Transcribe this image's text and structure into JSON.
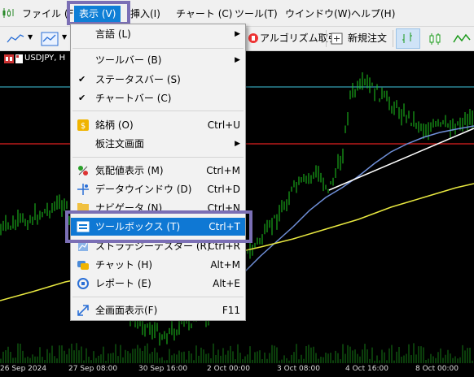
{
  "menubar": {
    "items": [
      {
        "label": "ファイル (F)"
      },
      {
        "label": "表示 (V)"
      },
      {
        "label": "挿入(I)"
      },
      {
        "label": "チャート (C)"
      },
      {
        "label": "ツール(T)"
      },
      {
        "label": "ウインドウ(W)"
      },
      {
        "label": "ヘルプ(H)"
      }
    ]
  },
  "toolbar": {
    "algo_label": "アルゴリズム取引",
    "new_order_label": "新規注文"
  },
  "chart_tab": {
    "label": "USDJPY, H"
  },
  "view_menu": {
    "items": [
      {
        "label": "言語 (L)",
        "shortcut": ""
      },
      {
        "label": "ツールバー (B)",
        "shortcut": ""
      },
      {
        "label": "ステータスバー (S)",
        "shortcut": ""
      },
      {
        "label": "チャートバー (C)",
        "shortcut": ""
      },
      {
        "label": "銘柄 (O)",
        "shortcut": "Ctrl+U"
      },
      {
        "label": "板注文画面",
        "shortcut": ""
      },
      {
        "label": "気配値表示 (M)",
        "shortcut": "Ctrl+M"
      },
      {
        "label": "データウインドウ (D)",
        "shortcut": "Ctrl+D"
      },
      {
        "label": "ナビゲータ (N)",
        "shortcut": "Ctrl+N"
      },
      {
        "label": "ツールボックス (T)",
        "shortcut": "Ctrl+T"
      },
      {
        "label": "ストラテジーテスター (R)",
        "shortcut": "Ctrl+R"
      },
      {
        "label": "チャット (H)",
        "shortcut": "Alt+M"
      },
      {
        "label": "レポート (E)",
        "shortcut": "Alt+E"
      },
      {
        "label": "全画面表示(F)",
        "shortcut": "F11"
      }
    ]
  },
  "time_axis": {
    "labels": [
      "26 Sep 2024",
      "27 Sep 08:00",
      "30 Sep 16:00",
      "2 Oct 00:00",
      "3 Oct 08:00",
      "4 Oct 16:00",
      "8 Oct 00:00"
    ]
  },
  "colors": {
    "accent": "#0f78d4",
    "highlight_box": "#7b6fb5",
    "candles": "#1ec81e",
    "ma_blue": "#6f8fd8",
    "ma_yellow": "#e8e840",
    "red_line": "#e02020",
    "cyan_line": "#40c8e0"
  }
}
